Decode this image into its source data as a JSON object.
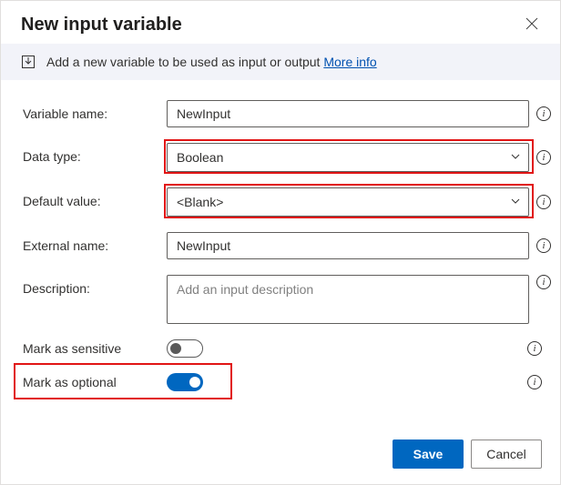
{
  "dialog": {
    "title": "New input variable",
    "close_aria": "Close"
  },
  "info": {
    "text": "Add a new variable to be used as input or output ",
    "link": "More info"
  },
  "fields": {
    "variable_name": {
      "label": "Variable name:",
      "value": "NewInput"
    },
    "data_type": {
      "label": "Data type:",
      "value": "Boolean"
    },
    "default_value": {
      "label": "Default value:",
      "value": "<Blank>"
    },
    "external_name": {
      "label": "External name:",
      "value": "NewInput"
    },
    "description": {
      "label": "Description:",
      "placeholder": "Add an input description"
    },
    "mark_sensitive": {
      "label": "Mark as sensitive",
      "value": false
    },
    "mark_optional": {
      "label": "Mark as optional",
      "value": true
    }
  },
  "buttons": {
    "save": "Save",
    "cancel": "Cancel"
  }
}
